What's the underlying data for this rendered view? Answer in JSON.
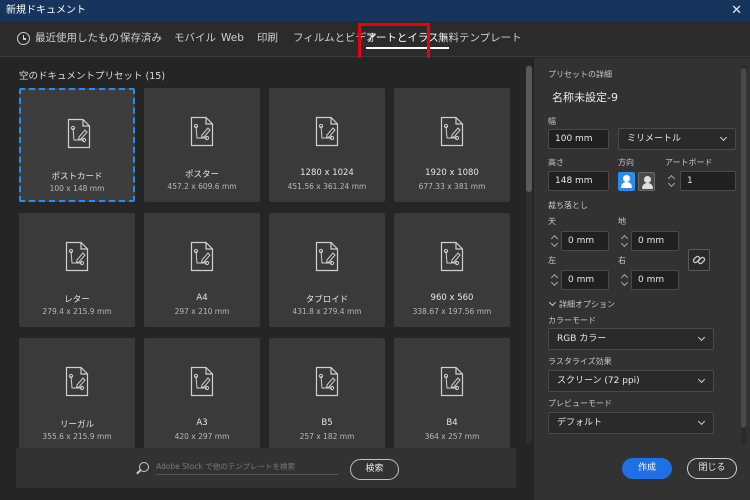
{
  "window": {
    "title": "新規ドキュメント",
    "close_glyph": "✕"
  },
  "tabs": [
    {
      "label": "最近使用したもの",
      "icon": "clock-icon"
    },
    {
      "label": "保存済み"
    },
    {
      "label": "モバイル"
    },
    {
      "label": "Web"
    },
    {
      "label": "印刷"
    },
    {
      "label": "フィルムとビデオ"
    },
    {
      "label": "アートとイラスト",
      "active": true
    },
    {
      "label": "無料テンプレート"
    }
  ],
  "presets": {
    "title": "空のドキュメントプリセット (15)",
    "items": [
      {
        "name": "ポストカード",
        "size": "100 x 148 mm",
        "selected": true
      },
      {
        "name": "ポスター",
        "size": "457.2 x 609.6 mm"
      },
      {
        "name": "1280 x 1024",
        "size": "451.56 x 361.24 mm"
      },
      {
        "name": "1920 x 1080",
        "size": "677.33 x 381 mm"
      },
      {
        "name": "レター",
        "size": "279.4 x 215.9 mm"
      },
      {
        "name": "A4",
        "size": "297 x 210 mm"
      },
      {
        "name": "タブロイド",
        "size": "431.8 x 279.4 mm"
      },
      {
        "name": "960 x 560",
        "size": "338.67 x 197.56 mm"
      },
      {
        "name": "リーガル",
        "size": "355.6 x 215.9 mm"
      },
      {
        "name": "A3",
        "size": "420 x 297 mm"
      },
      {
        "name": "B5",
        "size": "257 x 182 mm"
      },
      {
        "name": "B4",
        "size": "364 x 257 mm"
      }
    ]
  },
  "search": {
    "placeholder": "Adobe Stock で他のテンプレートを検索",
    "button": "検索"
  },
  "details": {
    "section_label": "プリセットの詳細",
    "name": "名称未設定-9",
    "width_label": "幅",
    "width_value": "100 mm",
    "unit": "ミリメートル",
    "height_label": "高さ",
    "height_value": "148 mm",
    "orientation_label": "方向",
    "artboard_label": "アートボード",
    "artboard_value": "1",
    "bleed_label": "裁ち落とし",
    "top_label": "天",
    "top_value": "0 mm",
    "bottom_label": "地",
    "bottom_value": "0 mm",
    "left_label": "左",
    "left_value": "0 mm",
    "right_label": "右",
    "right_value": "0 mm",
    "advanced_label": "詳細オプション",
    "color_mode_label": "カラーモード",
    "color_mode": "RGB カラー",
    "raster_label": "ラスタライズ効果",
    "raster_value": "スクリーン (72 ppi)",
    "preview_label": "プレビューモード",
    "preview_value": "デフォルト"
  },
  "footer": {
    "create": "作成",
    "close": "閉じる"
  },
  "colors": {
    "accent": "#2d8ceb",
    "primary_button": "#1f6fe5",
    "titlebar": "#17355c",
    "highlight": "#e60012"
  }
}
